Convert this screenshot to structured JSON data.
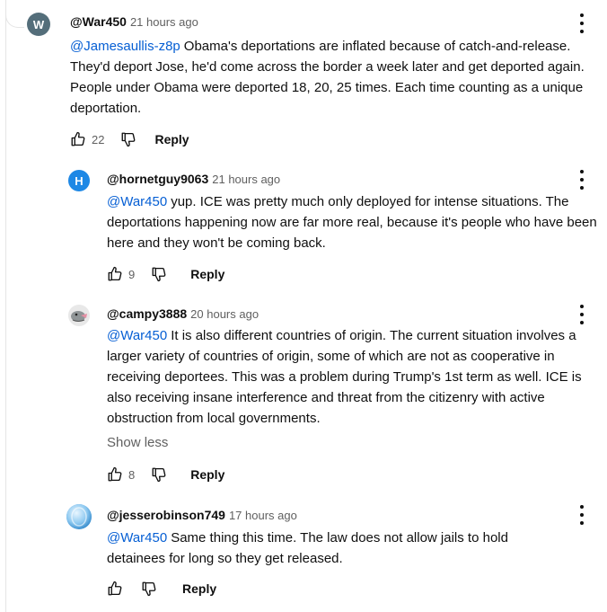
{
  "comments": [
    {
      "avatar_letter": "W",
      "avatar_color": "#546e7a",
      "author": "@War450",
      "time": "21 hours ago",
      "mention": "@Jamesaullis-z8p",
      "text": "Obama's deportations are inflated because of catch-and-release. They'd deport Jose, he'd come across the border a week later and get deported again. People under Obama were deported 18, 20, 25 times. Each time counting as a unique deportation.",
      "likes": "22",
      "reply_label": "Reply"
    },
    {
      "avatar_letter": "H",
      "avatar_color": "#1e88e5",
      "author": "@hornetguy9063",
      "time": "21 hours ago",
      "mention": "@War450",
      "text": "yup. ICE was pretty much only deployed for intense situations. The deportations happening now are far more real, because it's people who have been here and they won't be coming back.",
      "likes": "9",
      "reply_label": "Reply"
    },
    {
      "avatar_image": "bird-avatar",
      "author": "@campy3888",
      "time": "20 hours ago",
      "mention": "@War450",
      "text": "It is also different countries of origin. The current situation involves a larger variety of countries of origin, some of which are not as cooperative in receiving deportees. This was a problem during Trump's 1st term as well. ICE is also receiving insane interference and threat from the citizenry with active obstruction from local governments.",
      "show_less": "Show less",
      "likes": "8",
      "reply_label": "Reply"
    },
    {
      "avatar_image": "globe-avatar",
      "author": "@jesserobinson749",
      "time": "17 hours ago",
      "mention": "@War450",
      "text": "Same thing this time. The law does not allow jails to hold detainees for long so they get released.",
      "reply_label": "Reply"
    }
  ]
}
